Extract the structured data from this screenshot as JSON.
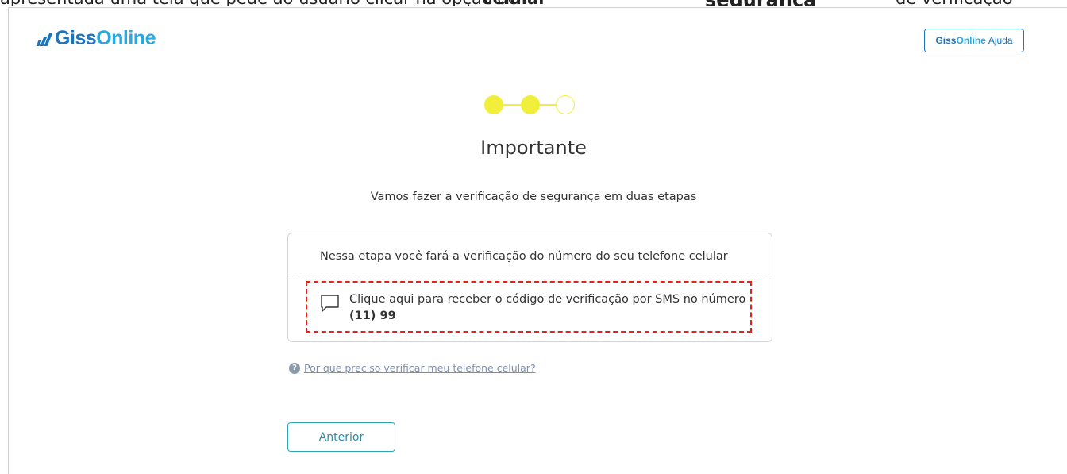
{
  "top_fragment": {
    "part1": "apresentada uma tela que pede ao usuário clicar na opção de",
    "part2": "celular",
    "part3": "segurança",
    "part4": "de verificação"
  },
  "header": {
    "logo_text_a": "Giss",
    "logo_text_b": "Online",
    "help_brand_a": "Giss",
    "help_brand_b": "Online",
    "help_label": "Ajuda"
  },
  "stepper": {
    "total_steps": 3,
    "completed_steps": 2,
    "accent_color": "#f2ef3c"
  },
  "main": {
    "title": "Importante",
    "subtitle": "Vamos fazer a verificação de segurança em duas etapas"
  },
  "card": {
    "header_text": "Nessa etapa você fará a verificação do número do seu telefone celular",
    "sms_icon": "chat-bubble-icon",
    "sms_text": "Clique aqui para receber o código de verificação por SMS no número",
    "sms_number": "(11) 99",
    "highlight_color": "#e32219"
  },
  "help_link": {
    "icon": "question-circle-icon",
    "text": "Por que preciso verificar meu telefone celular?"
  },
  "actions": {
    "previous_label": "Anterior"
  }
}
